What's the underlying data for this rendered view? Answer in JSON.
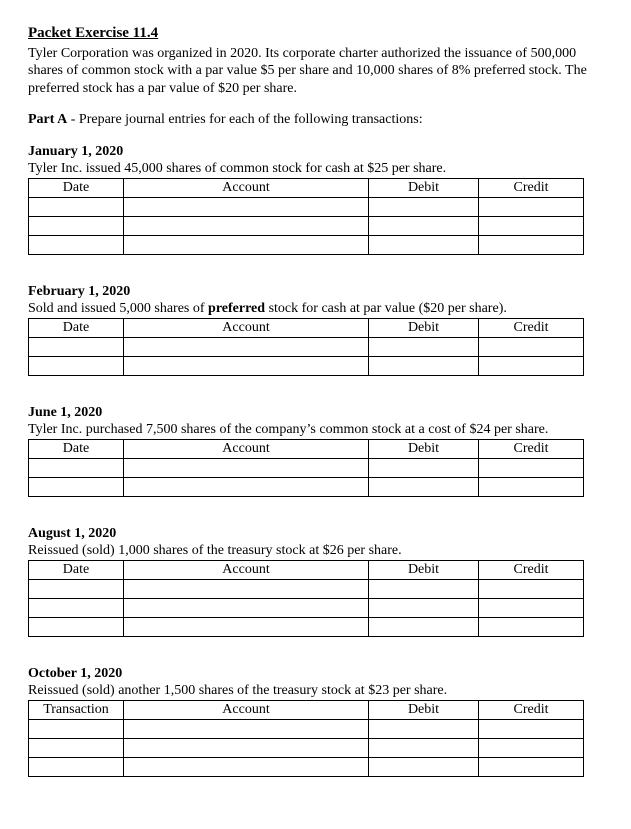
{
  "title": "Packet Exercise 11.4",
  "intro": "Tyler Corporation was organized in 2020.  Its corporate charter authorized the issuance of 500,000 shares of common stock with a par value $5 per share and 10,000 shares of 8% preferred stock. The preferred stock has a par value of $20 per share.",
  "partA_label": "Part A",
  "partA_rest": " - Prepare journal entries for each of the following transactions:",
  "cols": {
    "date": "Date",
    "account": "Account",
    "debit": "Debit",
    "credit": "Credit",
    "transaction": "Transaction"
  },
  "sections": [
    {
      "date": "January 1, 2020",
      "desc": "Tyler Inc. issued 45,000 shares of common stock for cash at $25 per share.",
      "rows": 3,
      "col1": "date"
    },
    {
      "date": "February 1, 2020",
      "desc_pre": "Sold and issued 5,000 shares of ",
      "desc_bold": "preferred",
      "desc_post": " stock for cash at par value ($20 per share).",
      "rows": 2,
      "col1": "date"
    },
    {
      "date": "June 1, 2020",
      "desc": "Tyler Inc. purchased 7,500 shares of the company’s common stock at a cost of $24 per share.",
      "rows": 2,
      "col1": "date"
    },
    {
      "date": "August 1, 2020",
      "desc": "Reissued (sold) 1,000 shares of the treasury stock at $26 per share.",
      "rows": 3,
      "col1": "date"
    },
    {
      "date": "October 1, 2020",
      "desc": "Reissued (sold) another 1,500 shares of the treasury stock at $23 per share.",
      "rows": 3,
      "col1": "transaction"
    }
  ]
}
